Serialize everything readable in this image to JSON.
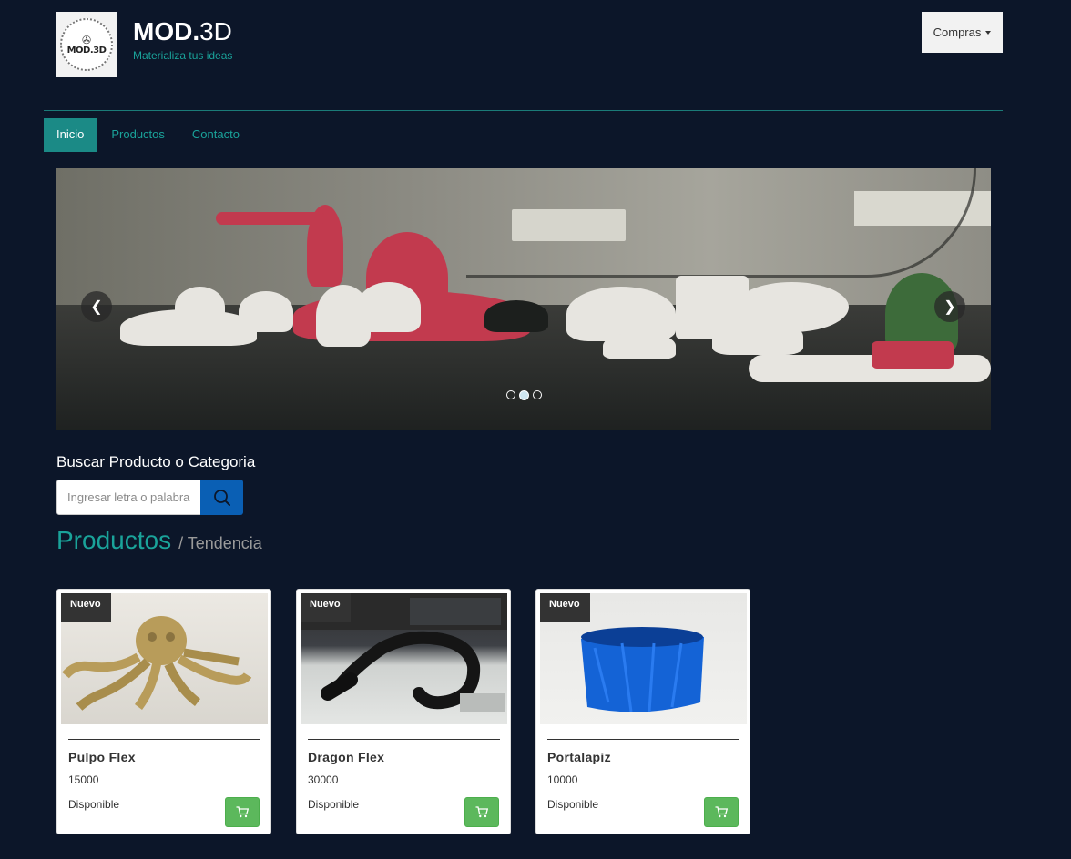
{
  "header": {
    "logo_text": "MOD.3D",
    "brand_bold": "MOD.",
    "brand_light": "3D",
    "tagline": "Materializa tus ideas",
    "compras_label": "Compras"
  },
  "nav": {
    "items": [
      {
        "label": "Inicio",
        "active": true
      },
      {
        "label": "Productos",
        "active": false
      },
      {
        "label": "Contacto",
        "active": false
      }
    ]
  },
  "carousel": {
    "prev_icon": "chevron-left-icon",
    "next_icon": "chevron-right-icon",
    "slide_count": 3,
    "active_slide": 2
  },
  "search": {
    "title": "Buscar Producto o Categoria",
    "placeholder": "Ingresar letra o palabra",
    "value": "",
    "button_icon": "search-icon"
  },
  "products_section": {
    "heading": "Productos",
    "subheading": "/ Tendencia"
  },
  "products": [
    {
      "badge": "Nuevo",
      "name": "Pulpo Flex",
      "price": "15000",
      "status": "Disponible",
      "cart_icon": "cart-icon"
    },
    {
      "badge": "Nuevo",
      "name": "Dragon Flex",
      "price": "30000",
      "status": "Disponible",
      "cart_icon": "cart-icon"
    },
    {
      "badge": "Nuevo",
      "name": "Portalapiz",
      "price": "10000",
      "status": "Disponible",
      "cart_icon": "cart-icon"
    }
  ],
  "colors": {
    "background": "#0c1629",
    "accent": "#1aa39a",
    "nav_active": "#1b8a86",
    "search_button": "#0a5fb4",
    "cart_button": "#5cb85c",
    "badge": "#333333"
  }
}
